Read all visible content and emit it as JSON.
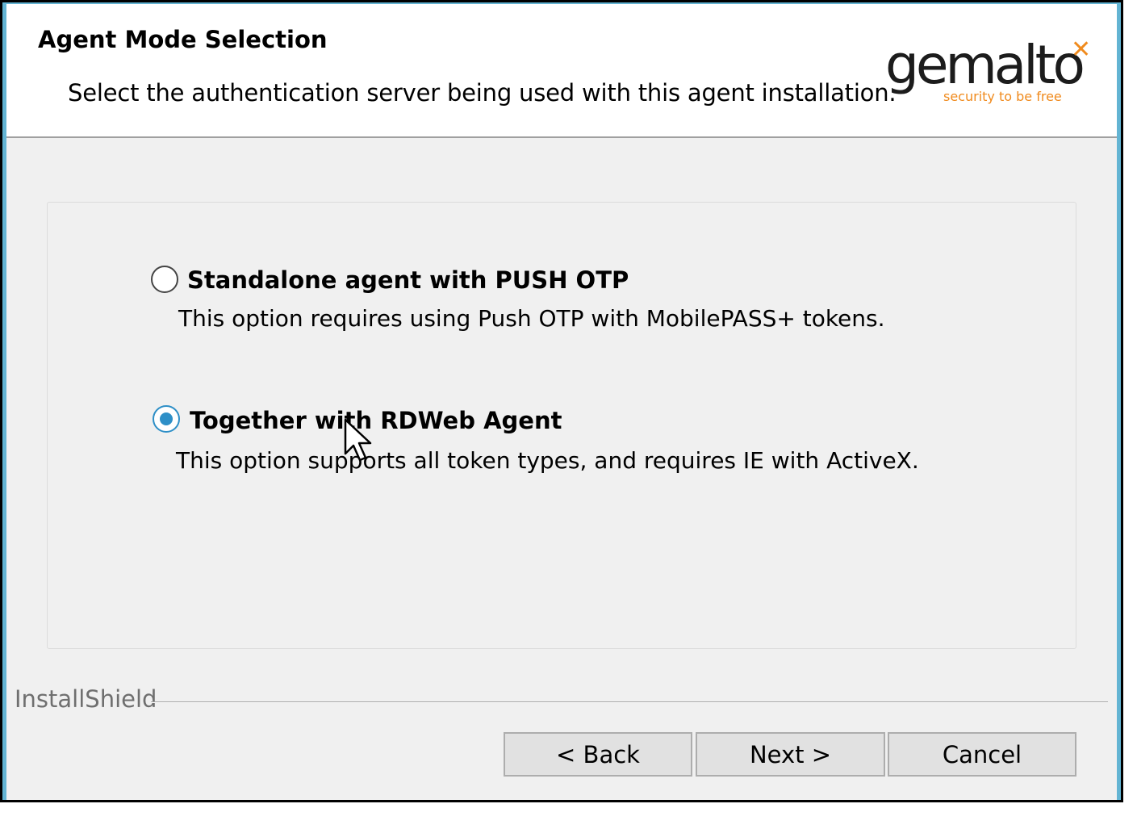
{
  "header": {
    "title": "Agent Mode Selection",
    "subtitle": "Select the authentication server being used with this agent installation."
  },
  "logo": {
    "wordmark": "gemalto",
    "tagline": "security to be free",
    "star": "✕"
  },
  "options": [
    {
      "label": "Standalone agent with PUSH OTP",
      "description": "This option requires using Push OTP with MobilePASS+ tokens.",
      "selected": false
    },
    {
      "label": "Together with RDWeb Agent",
      "description": "This option supports all token types, and requires IE with ActiveX.",
      "selected": true
    }
  ],
  "footer": {
    "brand": "InstallShield",
    "back_label": "< Back",
    "next_label": "Next >",
    "cancel_label": "Cancel"
  },
  "colors": {
    "accent": "#2e8fc7",
    "window_border": "#63b4d3",
    "logo_orange": "#f08b1e"
  }
}
